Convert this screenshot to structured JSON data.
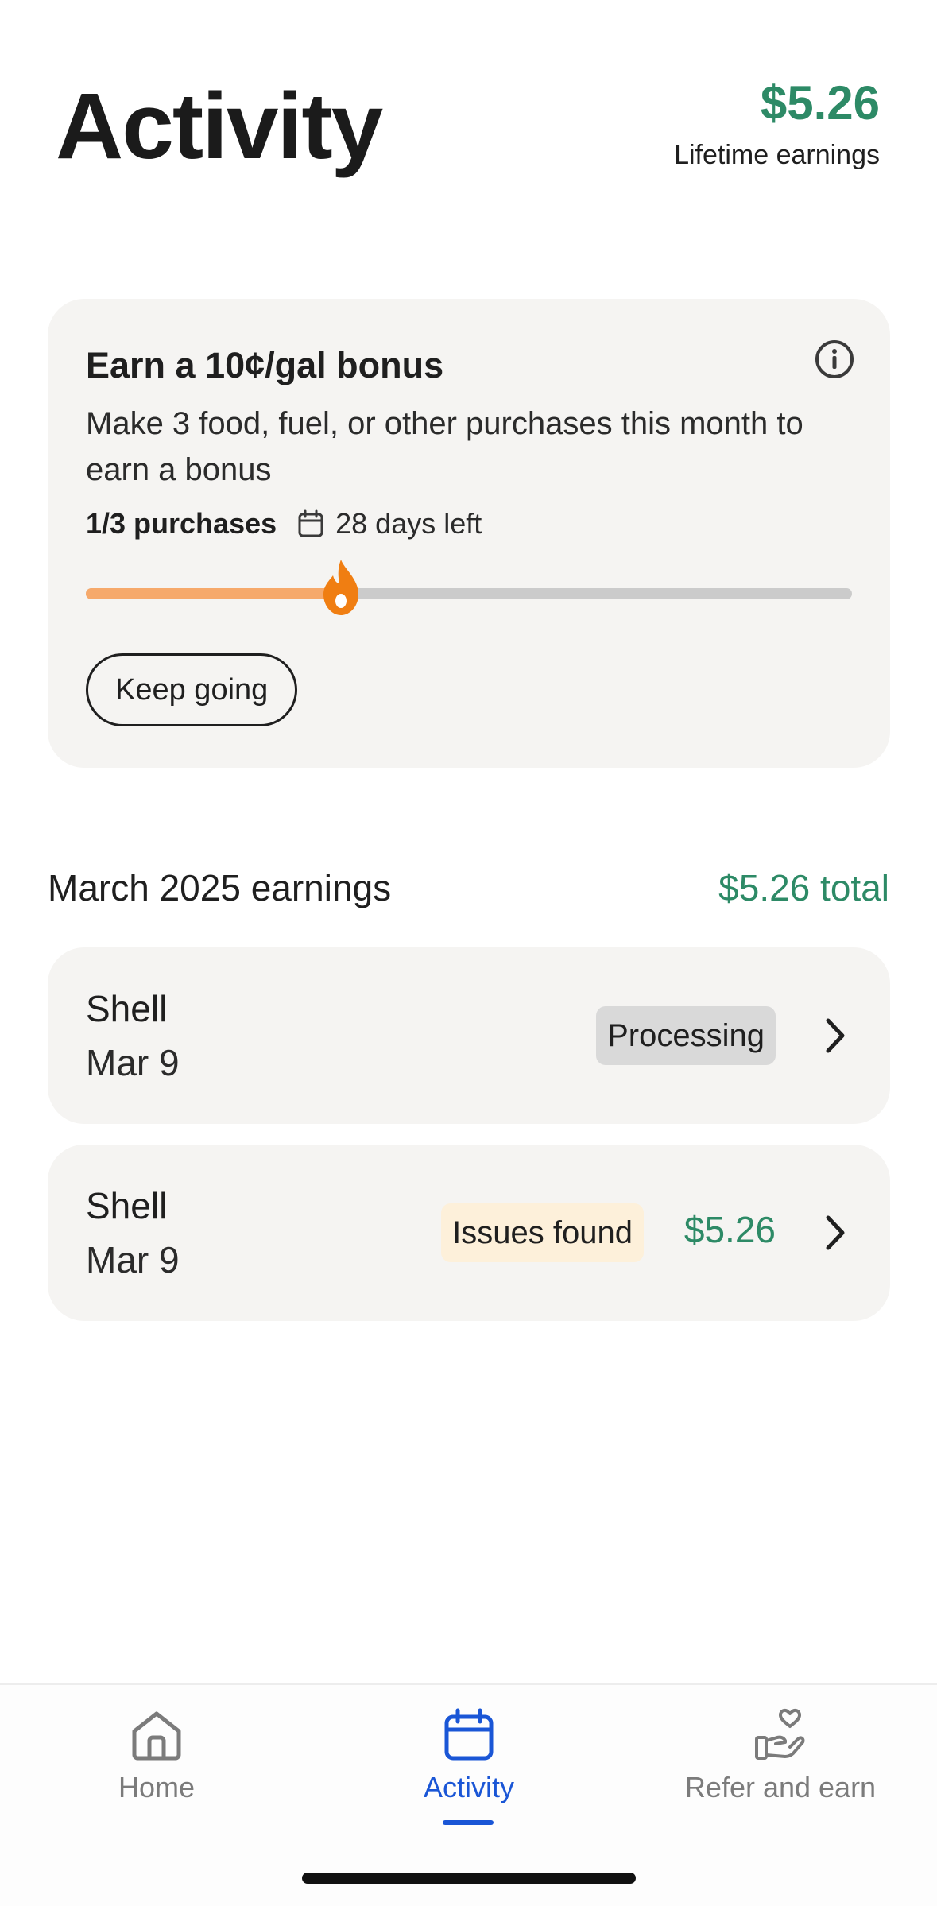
{
  "header": {
    "title": "Activity",
    "lifetime_amount": "$5.26",
    "lifetime_label": "Lifetime earnings"
  },
  "bonus": {
    "title": "Earn a 10¢/gal bonus",
    "description": "Make 3 food, fuel, or other purchases this month to earn a bonus",
    "count": "1/3 purchases",
    "days_left": "28 days left",
    "progress": 0.333,
    "button": "Keep going"
  },
  "earnings": {
    "title": "March 2025 earnings",
    "total": "$5.26 total",
    "transactions": [
      {
        "merchant": "Shell",
        "date": "Mar 9",
        "status": "Processing",
        "amount": ""
      },
      {
        "merchant": "Shell",
        "date": "Mar 9",
        "status": "Issues found",
        "amount": "$5.26"
      }
    ]
  },
  "nav": {
    "items": [
      {
        "label": "Home",
        "icon": "home-icon"
      },
      {
        "label": "Activity",
        "icon": "calendar-icon",
        "active": true
      },
      {
        "label": "Refer and earn",
        "icon": "refer-icon"
      }
    ]
  },
  "colors": {
    "accent_green": "#2d8a66",
    "active_blue": "#1a56d6",
    "progress_orange": "#f6a96b",
    "flame_orange": "#f07e12",
    "card_bg": "#f5f4f2"
  }
}
